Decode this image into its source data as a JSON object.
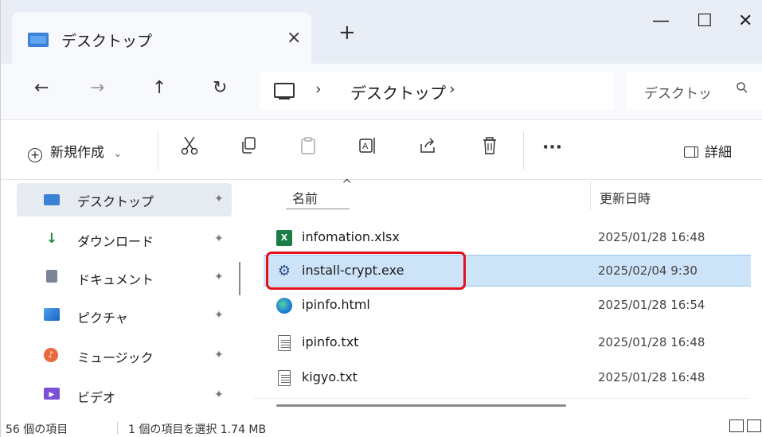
{
  "tab": {
    "title": "デスクトップ",
    "close": "×",
    "new_tab": "+"
  },
  "window_controls": {
    "minimize": "—",
    "maximize": "☐",
    "close": "✕"
  },
  "nav": {
    "back": "←",
    "forward": "→",
    "up": "↑",
    "refresh": "↻"
  },
  "address": {
    "sep1": "›",
    "location": "デスクトップ",
    "sep2": "›"
  },
  "search": {
    "placeholder": "デスクトッ",
    "icon": "search-icon"
  },
  "toolbar": {
    "new_label": "新規作成",
    "new_caret": "⌄",
    "more": "···",
    "details_label": "詳細"
  },
  "sidebar": {
    "items": [
      {
        "label": "デスクトップ",
        "icon": "desktop-icon",
        "selected": true
      },
      {
        "label": "ダウンロード",
        "icon": "download-icon"
      },
      {
        "label": "ドキュメント",
        "icon": "document-icon"
      },
      {
        "label": "ピクチャ",
        "icon": "pictures-icon"
      },
      {
        "label": "ミュージック",
        "icon": "music-icon"
      },
      {
        "label": "ビデオ",
        "icon": "video-icon"
      }
    ],
    "pin_glyph": "📌"
  },
  "columns": {
    "name": "名前",
    "modified": "更新日時"
  },
  "files": [
    {
      "name": "infomation.xlsx",
      "date": "2025/01/28 16:48",
      "icon": "excel-file-icon"
    },
    {
      "name": "install-crypt.exe",
      "date": "2025/02/04 9:30",
      "icon": "exe-file-icon",
      "selected": true,
      "highlighted": true
    },
    {
      "name": "ipinfo.html",
      "date": "2025/01/28 16:54",
      "icon": "edge-html-icon"
    },
    {
      "name": "ipinfo.txt",
      "date": "2025/01/28 16:48",
      "icon": "text-file-icon"
    },
    {
      "name": "kigyo.txt",
      "date": "2025/01/28 16:48",
      "icon": "text-file-icon"
    }
  ],
  "status": {
    "item_count": "56 個の項目",
    "selection": "1 個の項目を選択  1.74 MB"
  },
  "colors": {
    "highlight_box": "#e3101b",
    "selection": "#cde3f8",
    "accent": "#3b82d6"
  }
}
